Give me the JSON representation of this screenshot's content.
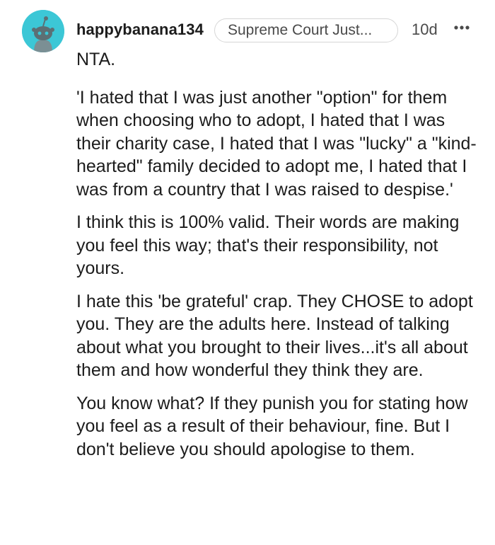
{
  "comment": {
    "author": "happybanana134",
    "flair": "Supreme Court Just...",
    "age": "10d",
    "more_icon": "ellipsis-horizontal-icon",
    "avatar_icon": "snoo-avatar-icon",
    "paragraphs": [
      "NTA.",
      "'I hated that I was just another \"option\" for them when choosing who to adopt, I hated that I was their charity case, I hated that I was \"lucky\" a \"kind-hearted\" family decided to adopt me, I hated that I was from a country that I was raised to despise.'",
      "I think this is 100% valid. Their words are making you feel this way; that's their responsibility, not yours.",
      "I hate this 'be grateful' crap. They CHOSE to adopt you. They are the adults here. Instead of talking about what you brought to their lives...it's all about them and how wonderful they think they are.",
      "You know what? If they punish you for stating how you feel as a result of their behaviour, fine. But I don't believe you should apologise to them."
    ]
  },
  "colors": {
    "avatar_bg": "#3cc7d6",
    "text": "#1c1c1c",
    "meta_text": "#4a4a4a",
    "flair_border": "#d6d6d6"
  }
}
